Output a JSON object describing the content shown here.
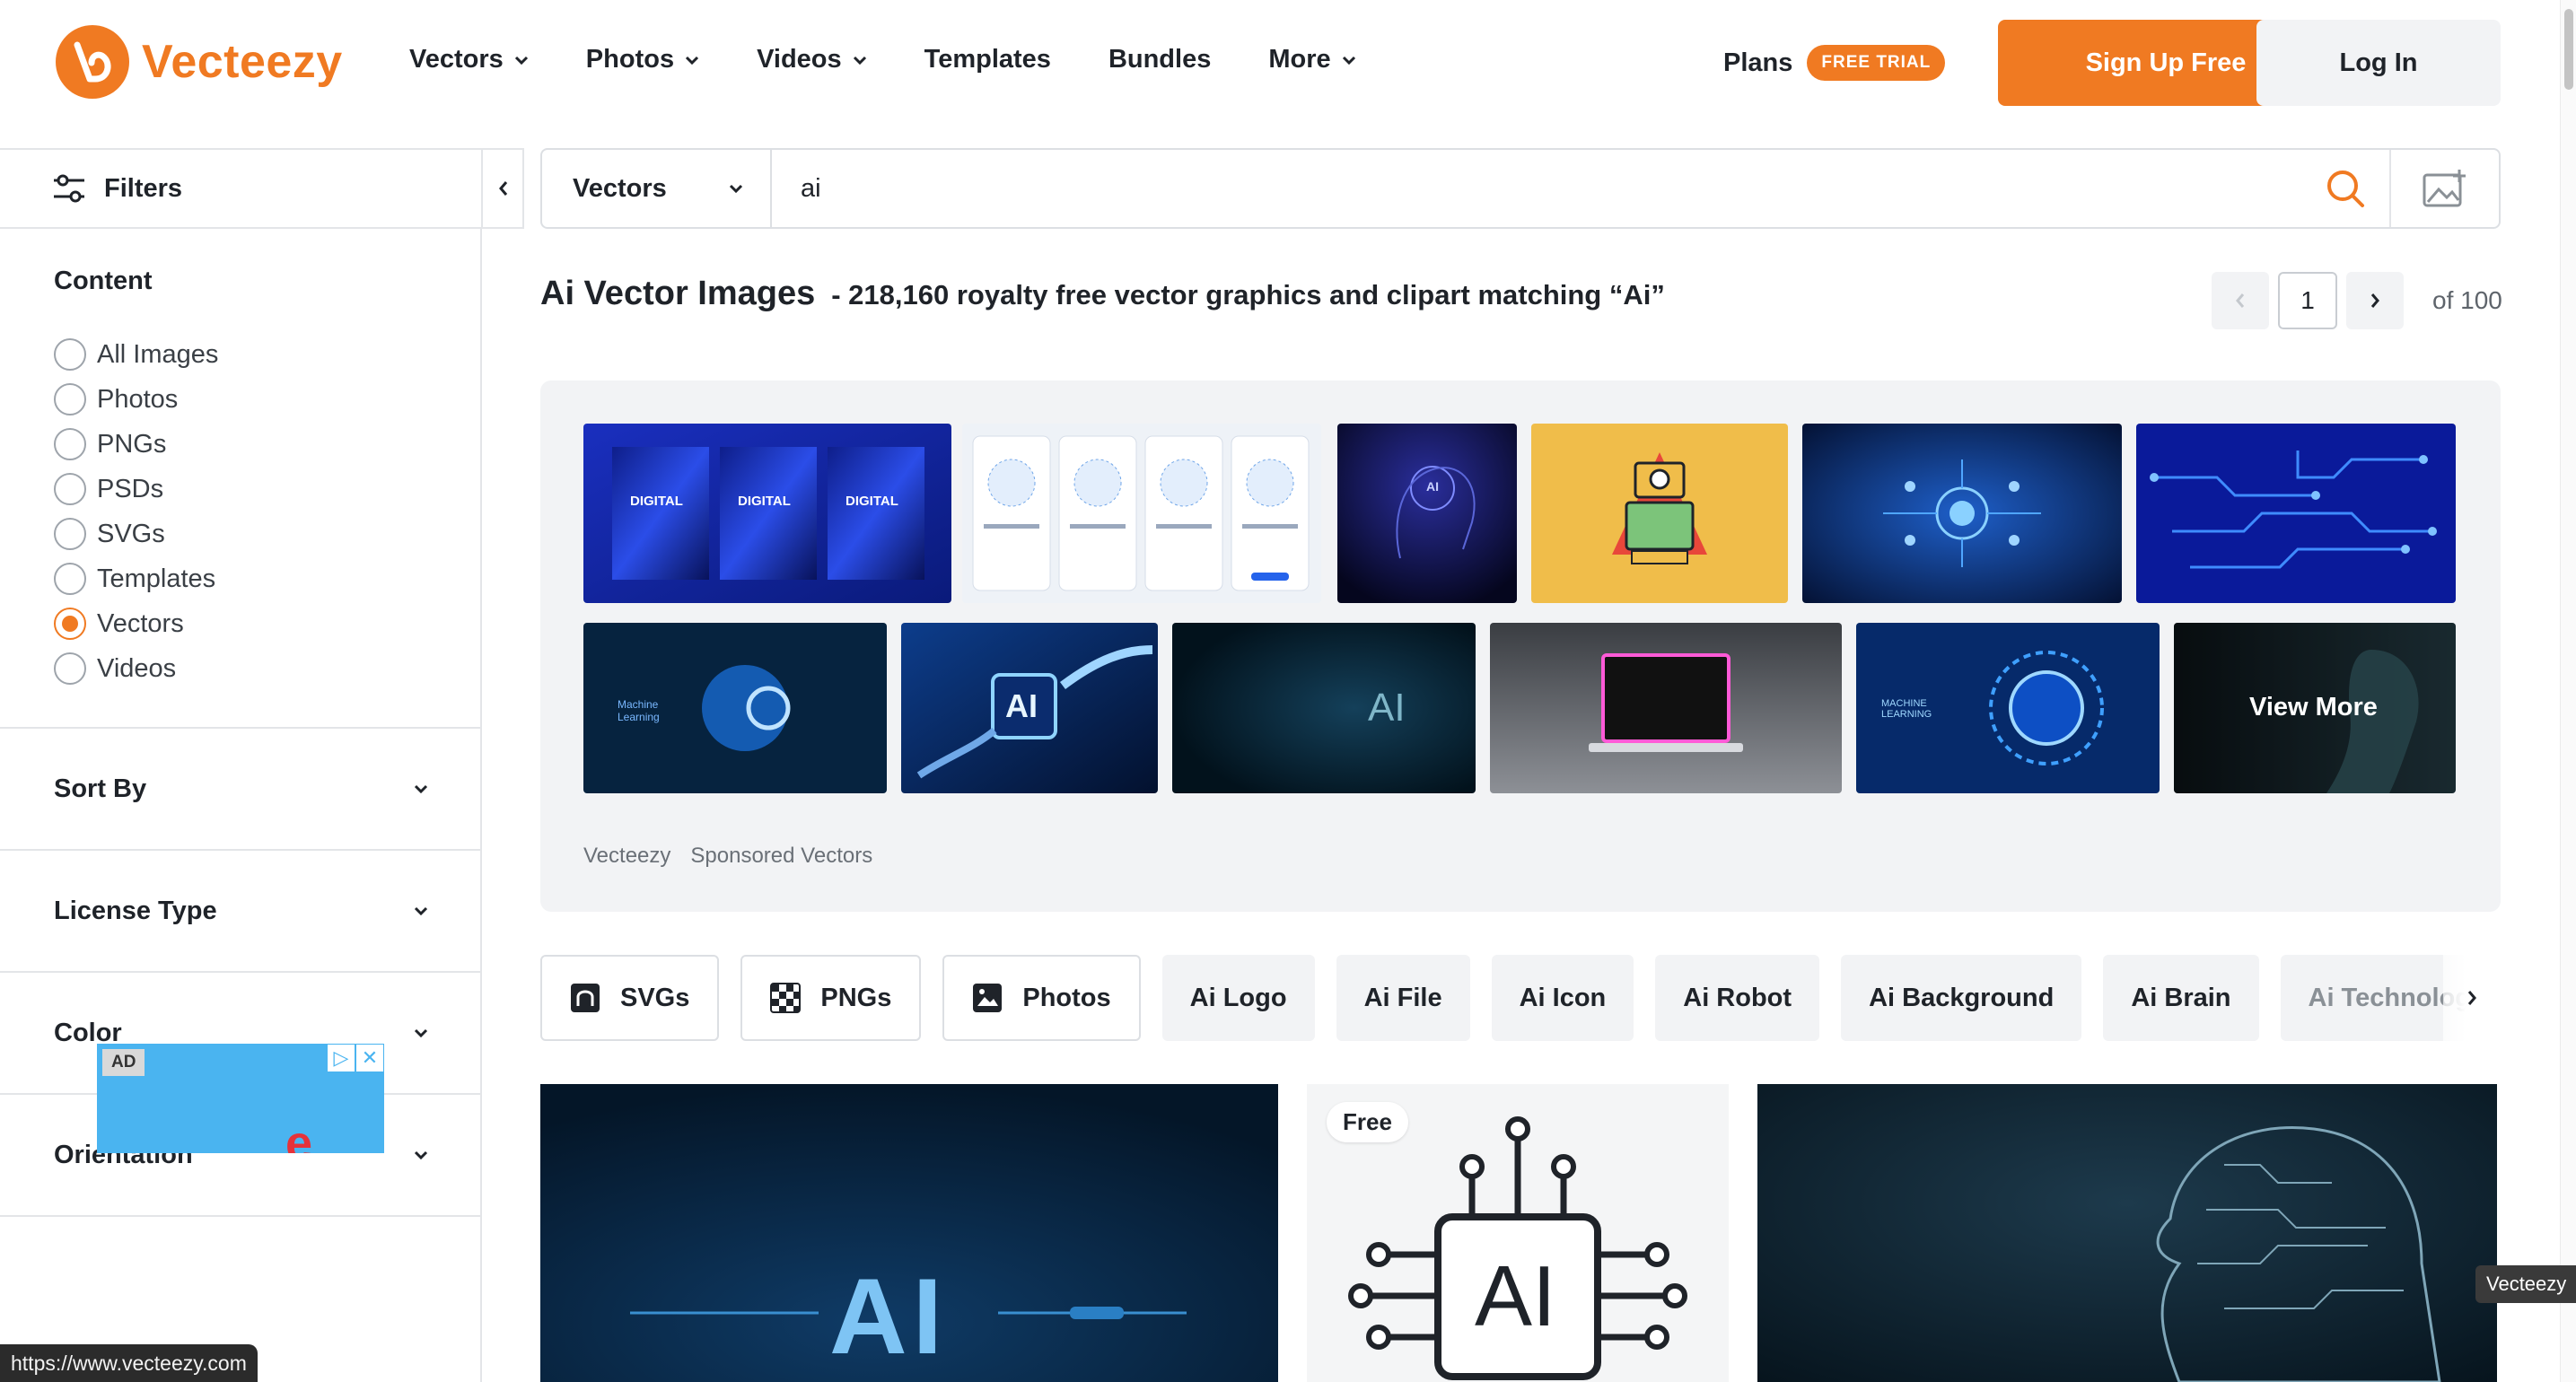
{
  "header": {
    "logo_text": "Vecteezy",
    "nav": [
      {
        "label": "Vectors",
        "has_dropdown": true
      },
      {
        "label": "Photos",
        "has_dropdown": true
      },
      {
        "label": "Videos",
        "has_dropdown": true
      },
      {
        "label": "Templates",
        "has_dropdown": false
      },
      {
        "label": "Bundles",
        "has_dropdown": false
      },
      {
        "label": "More",
        "has_dropdown": true
      }
    ],
    "plans_label": "Plans",
    "trial_badge": "FREE TRIAL",
    "signup_label": "Sign Up Free",
    "login_label": "Log In"
  },
  "filterbar": {
    "label": "Filters"
  },
  "search": {
    "type_selected": "Vectors",
    "query": "ai"
  },
  "sidebar": {
    "content_title": "Content",
    "content_options": [
      {
        "label": "All Images",
        "checked": false
      },
      {
        "label": "Photos",
        "checked": false
      },
      {
        "label": "PNGs",
        "checked": false
      },
      {
        "label": "PSDs",
        "checked": false
      },
      {
        "label": "SVGs",
        "checked": false
      },
      {
        "label": "Templates",
        "checked": false
      },
      {
        "label": "Vectors",
        "checked": true
      },
      {
        "label": "Videos",
        "checked": false
      }
    ],
    "sections": [
      "Sort By",
      "License Type",
      "Color",
      "Orientation"
    ],
    "ad_label": "AD"
  },
  "results": {
    "title": "Ai Vector Images",
    "subtitle": "- 218,160 royalty free vector graphics and clipart matching “Ai”",
    "page": "1",
    "page_total": "of 100"
  },
  "sponsored": {
    "thumb_texts": {
      "digital_1": "DIGITAL",
      "digital_2": "DIGITAL",
      "digital_3": "DIGITAL",
      "ai_small": "AI",
      "ai_chip": "AI",
      "ai_glow": "AI",
      "ml_1": "Machine Learning",
      "ml_2": "MACHINE LEARNING"
    },
    "view_more": "View More",
    "footer": [
      "Vecteezy",
      "Sponsored Vectors"
    ]
  },
  "chips": [
    {
      "label": "SVGs",
      "icon": "svg-icon",
      "style": "outline"
    },
    {
      "label": "PNGs",
      "icon": "png-checker-icon",
      "style": "outline"
    },
    {
      "label": "Photos",
      "icon": "photo-icon",
      "style": "outline"
    },
    {
      "label": "Ai Logo",
      "style": "fill"
    },
    {
      "label": "Ai File",
      "style": "fill"
    },
    {
      "label": "Ai Icon",
      "style": "fill"
    },
    {
      "label": "Ai Robot",
      "style": "fill"
    },
    {
      "label": "Ai Background",
      "style": "fill"
    },
    {
      "label": "Ai Brain",
      "style": "fill"
    },
    {
      "label": "Ai Technolog",
      "style": "fill"
    }
  ],
  "cards": {
    "card1_text": "AI",
    "card2_badge": "Free",
    "card2_text": "AI"
  },
  "tooltip_vecteezy": "Vecteezy",
  "status_url": "https://www.vecteezy.com",
  "colors": {
    "accent": "#f07a22",
    "panel": "#f2f3f5",
    "border": "#e3e5e8"
  }
}
